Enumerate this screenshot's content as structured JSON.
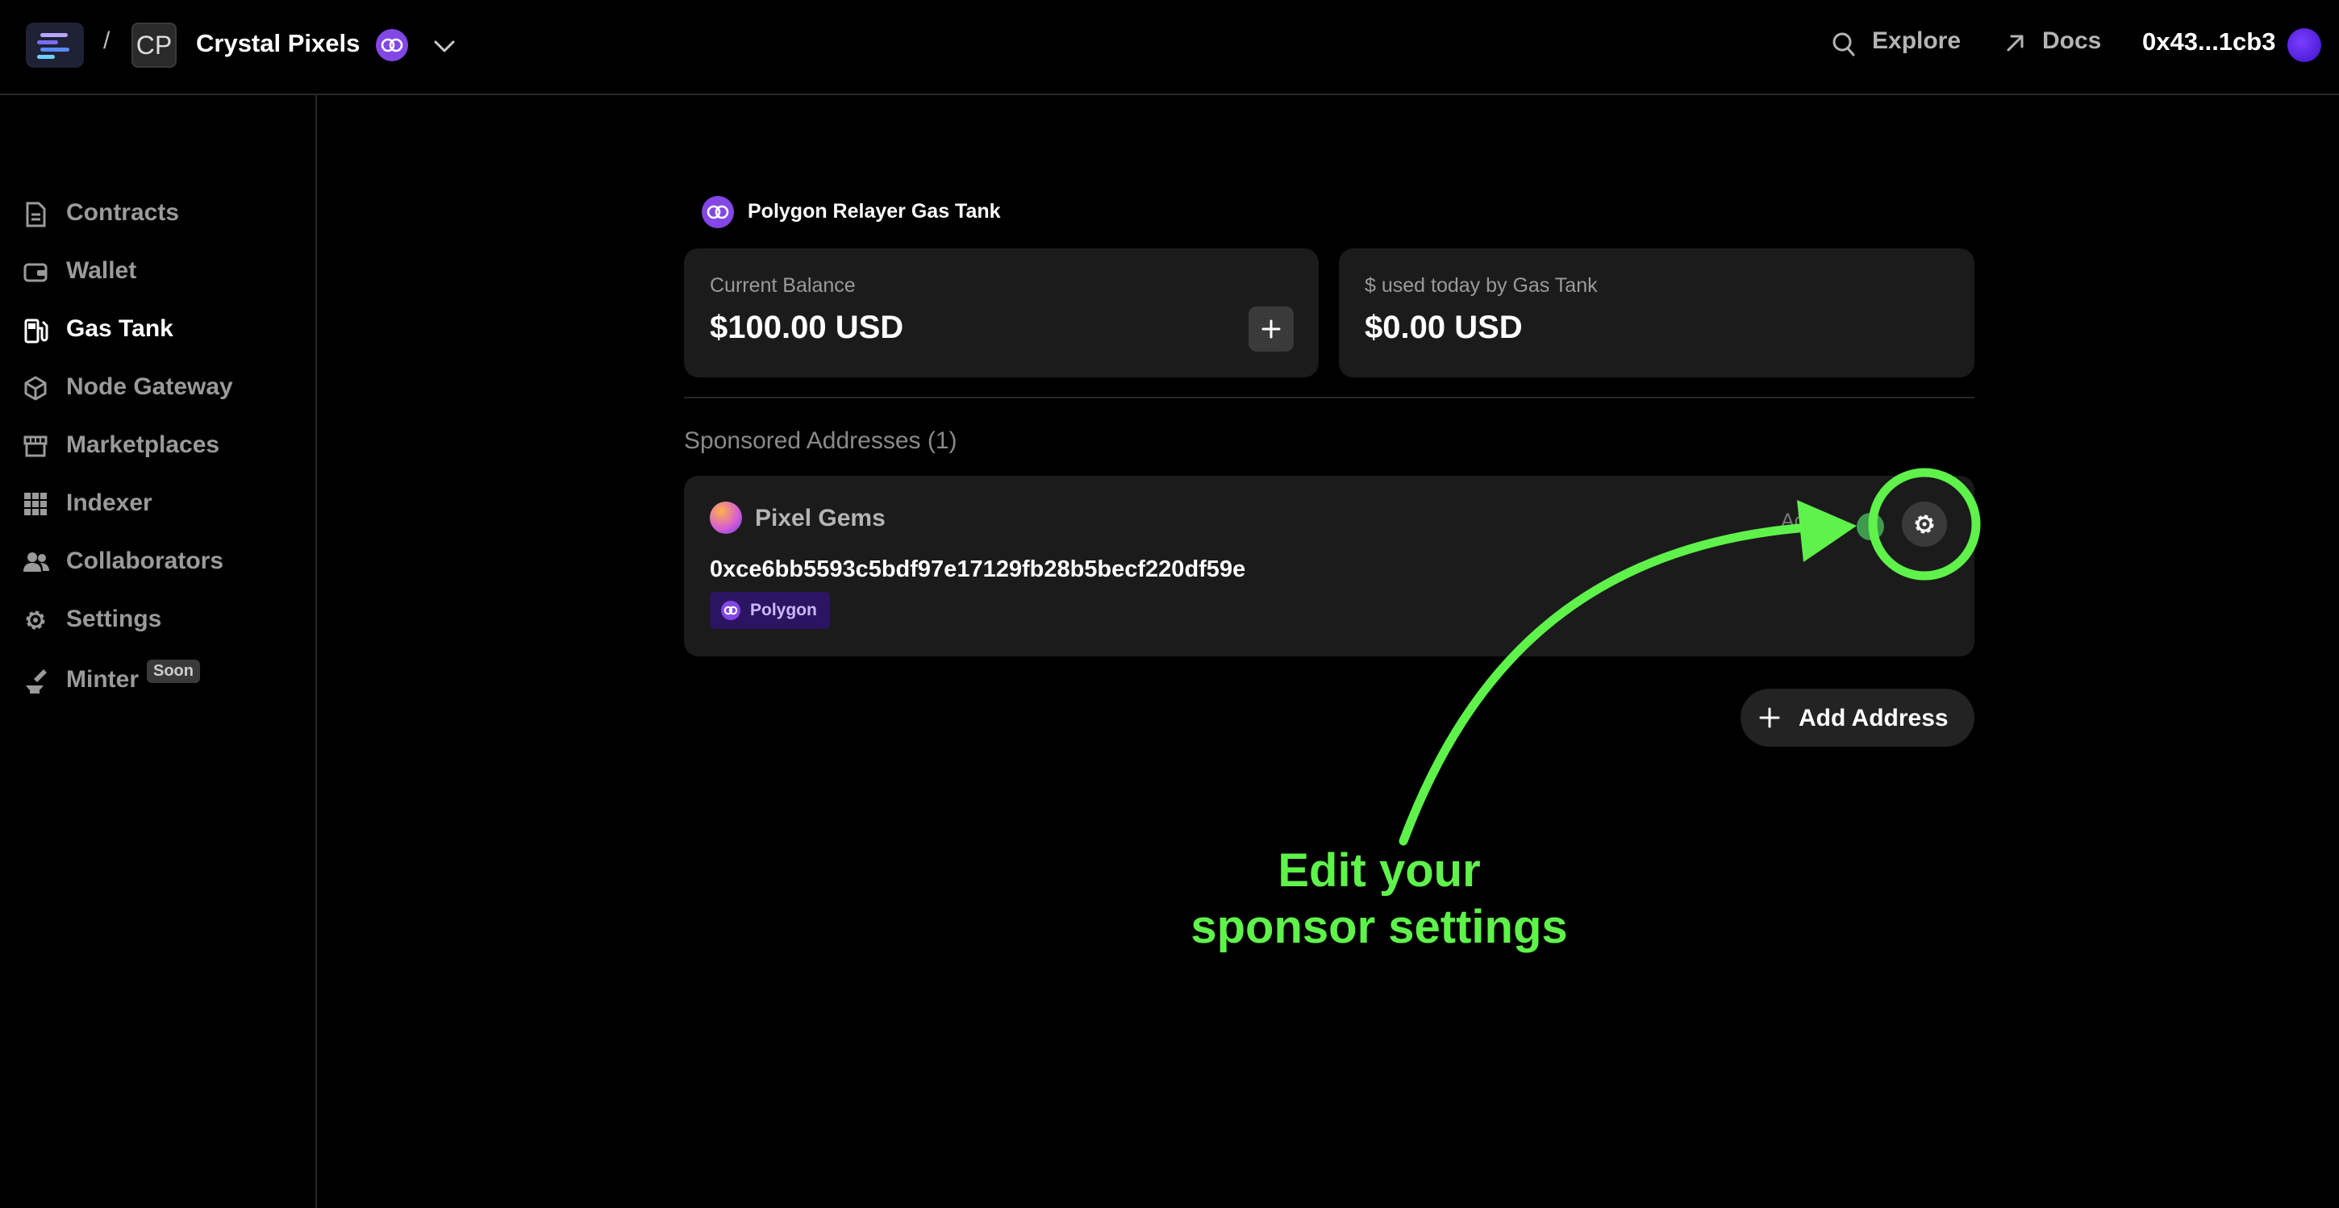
{
  "header": {
    "separator": "/",
    "project_initials": "CP",
    "project_name": "Crystal Pixels",
    "explore_label": "Explore",
    "docs_label": "Docs",
    "wallet_address": "0x43...1cb3"
  },
  "sidebar": {
    "items": [
      {
        "label": "Contracts",
        "icon": "contracts-icon"
      },
      {
        "label": "Wallet",
        "icon": "wallet-icon"
      },
      {
        "label": "Gas Tank",
        "icon": "fuel-pump-icon",
        "active": true
      },
      {
        "label": "Node Gateway",
        "icon": "cube-icon"
      },
      {
        "label": "Marketplaces",
        "icon": "storefront-icon"
      },
      {
        "label": "Indexer",
        "icon": "grid-icon"
      },
      {
        "label": "Collaborators",
        "icon": "people-icon"
      },
      {
        "label": "Settings",
        "icon": "gear-icon"
      },
      {
        "label": "Minter",
        "icon": "anvil-icon",
        "badge": "Soon"
      }
    ]
  },
  "gas_tank": {
    "title": "Polygon Relayer Gas Tank",
    "balance_label": "Current Balance",
    "balance_value": "$100.00 USD",
    "used_label": "$ used today by Gas Tank",
    "used_value": "$0.00 USD"
  },
  "sponsored": {
    "heading": "Sponsored Addresses (1)",
    "items": [
      {
        "name": "Pixel Gems",
        "address": "0xce6bb5593c5bdf97e17129fb28b5becf220df59e",
        "network": "Polygon",
        "status": "Active"
      }
    ],
    "add_label": "Add Address"
  },
  "annotation": {
    "line1": "Edit your",
    "line2": "sponsor settings",
    "color": "#5ff24b"
  },
  "colors": {
    "polygon": "#8247e5",
    "highlight": "#5ff24b"
  }
}
